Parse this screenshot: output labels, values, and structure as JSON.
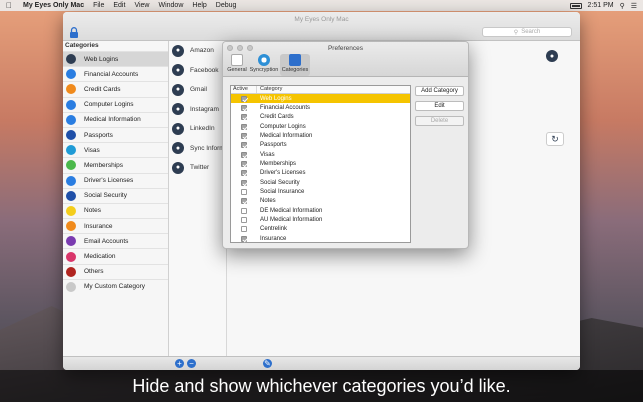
{
  "menubar": {
    "app_name": "My Eyes Only Mac",
    "items": [
      "File",
      "Edit",
      "View",
      "Window",
      "Help",
      "Debug"
    ],
    "clock": "2:51 PM"
  },
  "window": {
    "title": "My Eyes Only Mac",
    "search_placeholder": "Search"
  },
  "sidebar": {
    "header": "Categories",
    "items": [
      {
        "label": "Web Logins",
        "color": "#2e3d52"
      },
      {
        "label": "Financial Accounts",
        "color": "#2a7de1"
      },
      {
        "label": "Credit Cards",
        "color": "#f08a1c"
      },
      {
        "label": "Computer Logins",
        "color": "#2a7de1"
      },
      {
        "label": "Medical Information",
        "color": "#2a7de1"
      },
      {
        "label": "Passports",
        "color": "#1f4fa8"
      },
      {
        "label": "Visas",
        "color": "#1f9bd6"
      },
      {
        "label": "Memberships",
        "color": "#4bb84b"
      },
      {
        "label": "Driver's Licenses",
        "color": "#2a7de1"
      },
      {
        "label": "Social Security",
        "color": "#1f4fa8"
      },
      {
        "label": "Notes",
        "color": "#f4cd1c"
      },
      {
        "label": "Insurance",
        "color": "#f08a1c"
      },
      {
        "label": "Email Accounts",
        "color": "#7a3bb0"
      },
      {
        "label": "Medication",
        "color": "#d9366b"
      },
      {
        "label": "Others",
        "color": "#b0241f"
      },
      {
        "label": "My Custom Category",
        "color": "#c9c9c9"
      }
    ]
  },
  "accounts": [
    "Amazon",
    "Facebook",
    "Gmail",
    "Instagram",
    "LinkedIn",
    "Sync Inform",
    "Twitter"
  ],
  "preferences": {
    "title": "Preferences",
    "tabs": [
      "General",
      "Syncryption",
      "Categories"
    ],
    "col_active": "Active",
    "col_category": "Category",
    "rows": [
      {
        "label": "Web Logins",
        "active": true
      },
      {
        "label": "Financial Accounts",
        "active": true
      },
      {
        "label": "Credit Cards",
        "active": true
      },
      {
        "label": "Computer Logins",
        "active": true
      },
      {
        "label": "Medical Information",
        "active": true
      },
      {
        "label": "Passports",
        "active": true
      },
      {
        "label": "Visas",
        "active": true
      },
      {
        "label": "Memberships",
        "active": true
      },
      {
        "label": "Driver's Licenses",
        "active": true
      },
      {
        "label": "Social Security",
        "active": true
      },
      {
        "label": "Social Insurance",
        "active": false
      },
      {
        "label": "Notes",
        "active": true
      },
      {
        "label": "DE Medical Information",
        "active": false
      },
      {
        "label": "AU Medical Information",
        "active": false
      },
      {
        "label": "Centrelink",
        "active": false
      },
      {
        "label": "Insurance",
        "active": true
      }
    ],
    "buttons": {
      "add": "Add Category",
      "edit": "Edit",
      "delete": "Delete"
    }
  },
  "caption": "Hide and show whichever categories you’d like."
}
